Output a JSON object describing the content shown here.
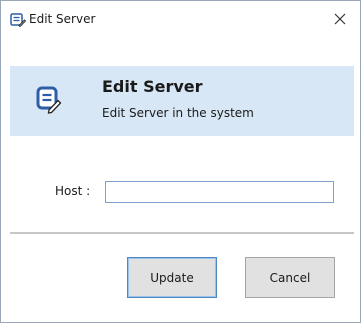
{
  "window": {
    "title": "Edit Server"
  },
  "header": {
    "title": "Edit Server",
    "subtitle": "Edit Server in the system"
  },
  "form": {
    "host_label": "Host :",
    "host_value": ""
  },
  "buttons": {
    "update_label": "Update",
    "cancel_label": "Cancel"
  },
  "colors": {
    "header_background": "#d7e7f6",
    "icon_blue": "#2c5fa6",
    "input_border": "#7ea2c9",
    "default_button_border": "#4f86c4"
  },
  "icons": {
    "title_icon": "edit-server-icon",
    "header_icon": "edit-server-icon",
    "close_icon": "close-icon"
  }
}
